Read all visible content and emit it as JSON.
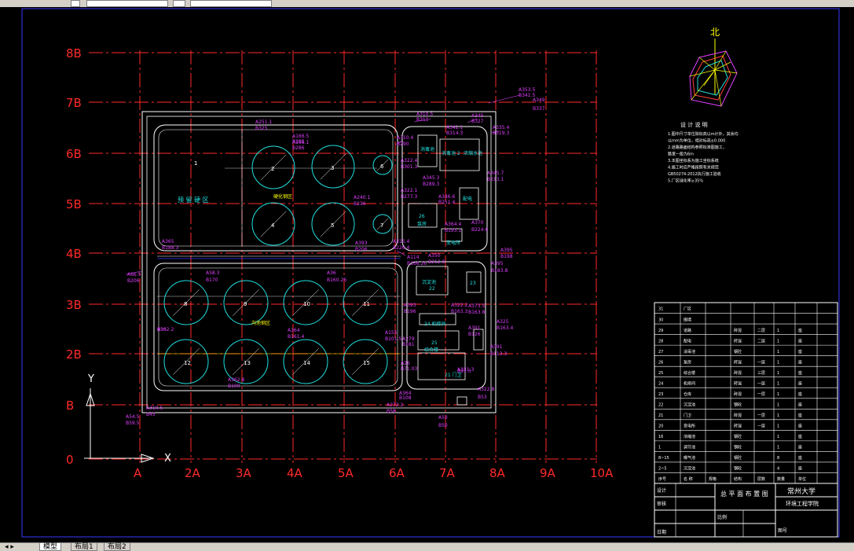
{
  "tabs": [
    {
      "label": "模型"
    },
    {
      "label": "布局1"
    },
    {
      "label": "布局2"
    }
  ],
  "grid": {
    "rows": [
      "8B",
      "7B",
      "6B",
      "5B",
      "4B",
      "3B",
      "2B",
      "B",
      "0"
    ],
    "cols": [
      "A",
      "2A",
      "3A",
      "4A",
      "5A",
      "6A",
      "7A",
      "8A",
      "9A",
      "10A"
    ]
  },
  "axes": {
    "y": "Y",
    "x": "X"
  },
  "north": "北",
  "areas": {
    "preprocess": "预 留 硬 区",
    "north_zone": "硬化钢区",
    "south_zone": "沟池钢区"
  },
  "tanks": [
    "1",
    "2",
    "3",
    "4",
    "5",
    "6",
    "7",
    "8",
    "9",
    "10",
    "11",
    "12",
    "13",
    "14",
    "15"
  ],
  "buildings": [
    {
      "id": "b1",
      "label": "消毒池"
    },
    {
      "id": "b2",
      "label": "消毒池 2"
    },
    {
      "id": "b3",
      "label": "浓缩水池"
    },
    {
      "id": "b4",
      "label": "配电"
    },
    {
      "id": "b26",
      "label": "26"
    },
    {
      "id": "b26b",
      "label": "泵房"
    },
    {
      "id": "b20",
      "label": "变电所"
    },
    {
      "id": "b22a",
      "label": "沉淀池"
    },
    {
      "id": "b22b",
      "label": "22"
    },
    {
      "id": "b23",
      "label": "23"
    },
    {
      "id": "b24",
      "label": "24 机修间"
    },
    {
      "id": "b25",
      "label": "25"
    },
    {
      "id": "b25b",
      "label": "综合楼"
    },
    {
      "id": "b21",
      "label": "21 门卫"
    }
  ],
  "coords": [
    "A353.5",
    "B341.5",
    "A349",
    "B337",
    "A345",
    "B327",
    "A310.5",
    "B311",
    "A335.4",
    "B319.3",
    "A342.1",
    "B314.3",
    "A251.1",
    "B325",
    "A166.5",
    "B295",
    "A166.1",
    "B286",
    "A310.4",
    "B290",
    "A322.4",
    "B301.3",
    "A322.1",
    "B277.3",
    "A345.3",
    "B289.3",
    "A240.1",
    "B236",
    "A346.6",
    "B251.4",
    "A364.4",
    "B193.1",
    "A370",
    "B224.6",
    "A393",
    "B206",
    "A315.4",
    "B226.4",
    "A350",
    "B212.6",
    "A345.7",
    "B213.1",
    "A395",
    "B198",
    "A395",
    "B183.8",
    "A365",
    "B188.3",
    "A66.5",
    "B206",
    "A58.3",
    "B170",
    "A36",
    "B160.26",
    "A114",
    "B166.26",
    "A393",
    "B196",
    "A322.2",
    "B163.3",
    "A373.5",
    "B163.8",
    "A364",
    "B161.4",
    "A155",
    "B101.5",
    "A279",
    "B181",
    "A325",
    "B163.4",
    "A391",
    "B126",
    "A391",
    "B113.3",
    "A362.8",
    "B100",
    "A26",
    "B71.03",
    "A321.3",
    "B97.3",
    "A364",
    "B108",
    "A322.8",
    "B53",
    "A272.2",
    "B58",
    "A310.5",
    "B45",
    "A54.5",
    "B59.5",
    "A50",
    "B50",
    "A362.2",
    "B50",
    "A36.5",
    "B50"
  ],
  "notes": {
    "title": "设 计 说 明",
    "lines": [
      "1.图中尺寸单位除标高以m计外，其余均",
      "以mm为单位，相对标高±0.000",
      "2.道路路面结构参照标准图施工，",
      "路宽一般为6m",
      "3.本图坐标系为施工坐标系统",
      "4.施工时应严格按照有关规范",
      "GB50274-2012执行施工验收",
      "5.厂区绿化率≥35%"
    ]
  },
  "titleblock": {
    "school": "常州大学",
    "drawing": "总 平 面 布 置 图",
    "college": "环境工程学院",
    "design": "设计",
    "check": "审核",
    "scale": "比例",
    "sheet": "图号",
    "date": "日期"
  },
  "table_rows": [
    [
      "31",
      "厂区",
      "",
      "",
      "",
      "",
      ""
    ],
    [
      "30",
      "围墙",
      "",
      "",
      "",
      "",
      ""
    ],
    [
      "29",
      "道路",
      "",
      "砖混",
      "二层",
      "1",
      "座"
    ],
    [
      "28",
      "配电",
      "",
      "砖混",
      "二层",
      "1",
      "座"
    ],
    [
      "27",
      "消毒池",
      "",
      "钢砼",
      "",
      "1",
      "座"
    ],
    [
      "26",
      "泵房",
      "",
      "砖混",
      "一层",
      "1",
      "座"
    ],
    [
      "25",
      "综合楼",
      "",
      "砖混",
      "三层",
      "1",
      "座"
    ],
    [
      "24",
      "机修间",
      "",
      "砖混",
      "一层",
      "1",
      "座"
    ],
    [
      "23",
      "仓库",
      "",
      "砖混",
      "一层",
      "1",
      "座"
    ],
    [
      "22",
      "沉淀池",
      "",
      "钢砼",
      "",
      "1",
      "座"
    ],
    [
      "21",
      "门卫",
      "",
      "砖混",
      "一层",
      "1",
      "座"
    ],
    [
      "20",
      "变电所",
      "",
      "砖混",
      "一层",
      "1",
      "座"
    ],
    [
      "16",
      "浓缩池",
      "",
      "钢砼",
      "",
      "1",
      "座"
    ],
    [
      "1",
      "调节池",
      "",
      "钢砼",
      "",
      "1",
      "座"
    ],
    [
      "8~15",
      "曝气池",
      "",
      "钢砼",
      "",
      "8",
      "座"
    ],
    [
      "2~5",
      "沉淀池",
      "",
      "钢砼",
      "",
      "4",
      "座"
    ],
    [
      "序号",
      "名 称",
      "规格",
      "结构",
      "层数",
      "数量",
      "单位"
    ]
  ]
}
